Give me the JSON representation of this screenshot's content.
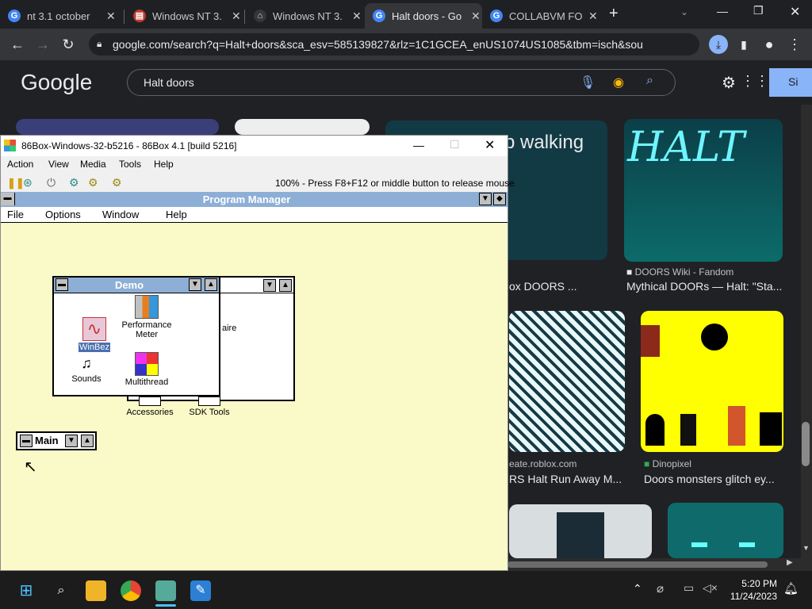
{
  "browser": {
    "tabs": [
      {
        "label": "nt 3.1 october",
        "favicon": "G",
        "color": "#4285f4"
      },
      {
        "label": "Windows NT 3.",
        "favicon": "pdf-icon",
        "color": "#c0392b"
      },
      {
        "label": "Windows NT 3.",
        "favicon": "museum-icon",
        "color": "#e8eaed"
      },
      {
        "label": "Halt doors - Go",
        "favicon": "G",
        "color": "#4285f4"
      },
      {
        "label": "COLLABVM FO",
        "favicon": "G",
        "color": "#4285f4"
      }
    ],
    "new_tab": "+",
    "url": "google.com/search?q=Halt+doors&sca_esv=585139827&rlz=1C1GCEA_enUS1074US1085&tbm=isch&sou...",
    "search_query": "Halt doors",
    "logo": "Google",
    "signin": "Si"
  },
  "results": {
    "top_headline": "p walking",
    "halt_art": "HALT",
    "cards": [
      {
        "source": "DOORS Wiki - Fandom",
        "title": "Mythical DOORs — Halt: \"Sta..."
      },
      {
        "source": "",
        "title": "ox DOORS ..."
      },
      {
        "source": "eate.roblox.com",
        "title": "RS Halt Run Away M..."
      },
      {
        "source": "Dinopixel",
        "title": "Doors monsters glitch ey..."
      }
    ]
  },
  "box86": {
    "title": "86Box-Windows-32-b5216 - 86Box 4.1 [build 5216]",
    "menu": [
      "Action",
      "View",
      "Media",
      "Tools",
      "Help"
    ],
    "status": "100% - Press F8+F12 or middle button to release mouse"
  },
  "program_manager": {
    "title": "Program Manager",
    "menu": [
      "File",
      "Options",
      "Window",
      "Help"
    ],
    "demo_group": {
      "title": "Demo",
      "icons": [
        "WinBez",
        "Performance Meter",
        "Sounds",
        "Multithread"
      ]
    },
    "behind_group_label": "aire",
    "group_icons": [
      "Accessories",
      "SDK Tools"
    ],
    "main_group": "Main"
  },
  "taskbar": {
    "time": "5:20 PM",
    "date": "11/24/2023"
  }
}
